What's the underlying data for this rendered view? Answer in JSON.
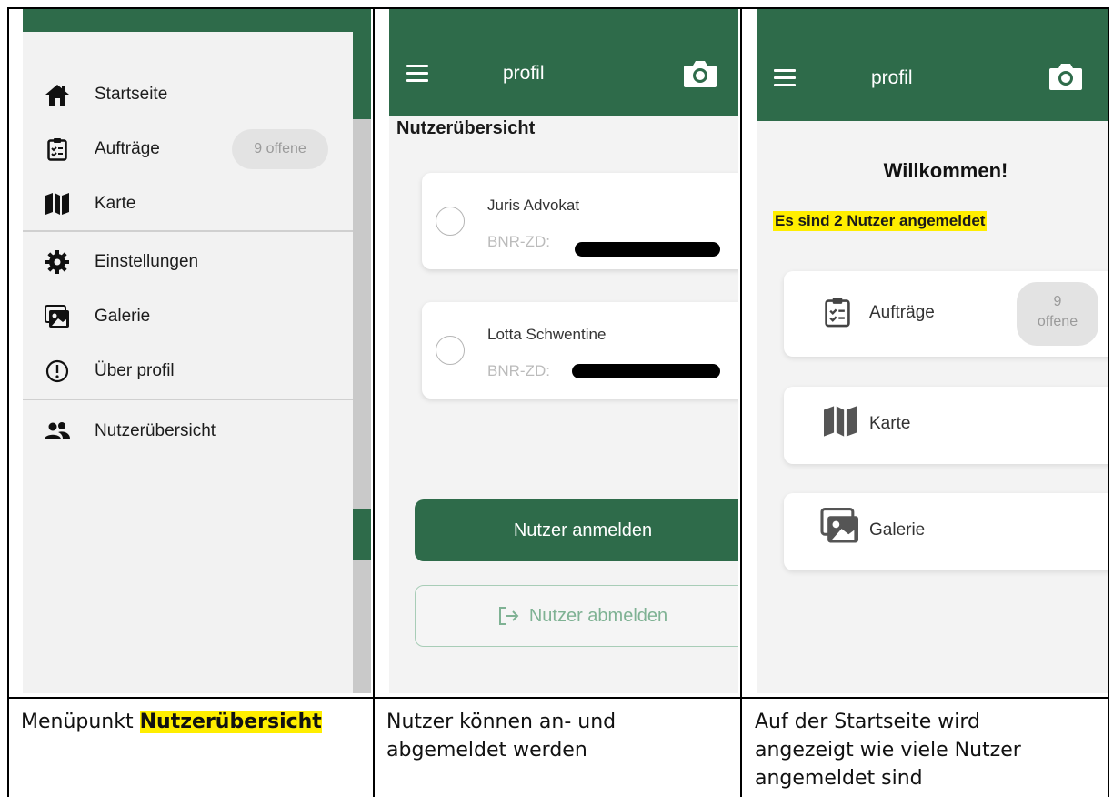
{
  "colors": {
    "brand_green": "#2e6b4a",
    "highlight": "#ffee00"
  },
  "panel1": {
    "menu": [
      {
        "icon": "home-icon",
        "label": "Startseite"
      },
      {
        "icon": "clipboard-list-icon",
        "label": "Aufträge",
        "badge": "9 offene"
      },
      {
        "icon": "map-icon",
        "label": "Karte"
      },
      {
        "icon": "gear-icon",
        "label": "Einstellungen"
      },
      {
        "icon": "gallery-icon",
        "label": "Galerie"
      },
      {
        "icon": "info-circle-icon",
        "label": "Über profil"
      },
      {
        "icon": "users-icon",
        "label": "Nutzerübersicht"
      }
    ],
    "caption_prefix": "Menüpunkt",
    "caption_highlight": "Nutzerübersicht"
  },
  "panel2": {
    "app_title": "profil",
    "heading": "Nutzerübersicht",
    "users": [
      {
        "name": "Juris Advokat",
        "bnr_label": "BNR-ZD:"
      },
      {
        "name": "Lotta Schwentine",
        "bnr_label": "BNR-ZD:"
      }
    ],
    "login_button": "Nutzer anmelden",
    "logout_button": "Nutzer abmelden",
    "caption": "Nutzer können an- und abgemeldet werden"
  },
  "panel3": {
    "app_title": "profil",
    "welcome": "Willkommen!",
    "logged_in_text": "Es sind 2 Nutzer angemeldet",
    "tiles": [
      {
        "icon": "clipboard-list-icon",
        "label": "Aufträge",
        "badge_count": "9",
        "badge_text": "offene"
      },
      {
        "icon": "map-icon",
        "label": "Karte"
      },
      {
        "icon": "gallery-icon",
        "label": "Galerie"
      }
    ],
    "caption": "Auf der Startseite wird angezeigt wie viele Nutzer angemeldet sind"
  }
}
